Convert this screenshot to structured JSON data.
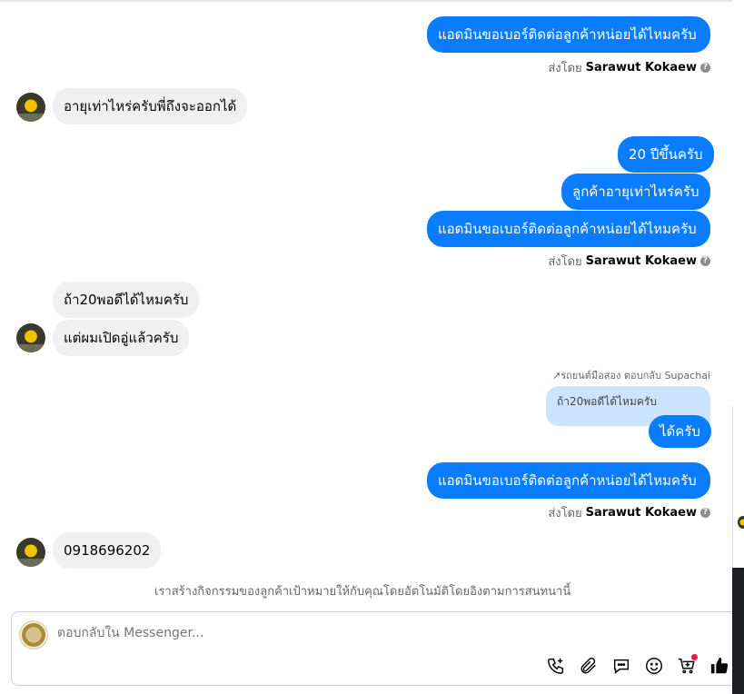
{
  "messages": [
    {
      "text": "แอดมินขอเบอร์ติดต่อลูกค้าหน่อยได้ไหมครับ"
    },
    {
      "sender_prefix": "ส่งโดย",
      "sender_name": "Sarawut Kokaew"
    },
    {
      "text": "อายุเท่าไหร่ครับพี่ถึงจะออกได้"
    },
    {
      "text": "20 ปีขึ้นครับ"
    },
    {
      "text": "ลูกค้าอายุเท่าไหร่ครับ"
    },
    {
      "text": "แอดมินขอเบอร์ติดต่อลูกค้าหน่อยได้ไหมครับ"
    },
    {
      "sender_prefix": "ส่งโดย",
      "sender_name": "Sarawut Kokaew"
    },
    {
      "text": "ถ้า20พอดีได้ไหมครับ"
    },
    {
      "text": "แต่ผมเปิดอู่แล้วครับ"
    },
    {
      "reply_note": "รถยนต์มือสอง ตอบกลับ Supachai",
      "quoted": "ถ้า20พอดีได้ไหมครับ"
    },
    {
      "text": "ได้ครับ"
    },
    {
      "text": "แอดมินขอเบอร์ติดต่อลูกค้าหน่อยได้ไหมครับ"
    },
    {
      "sender_prefix": "ส่งโดย",
      "sender_name": "Sarawut Kokaew"
    },
    {
      "text": "0918696202"
    }
  ],
  "system_note": "เราสร้างกิจกรรมของลูกค้าเป้าหมายให้กับคุณโดยอัตโนมัติโดยอิงตามการสนทนานี้",
  "composer": {
    "placeholder": "ตอบกลับใน Messenger..."
  },
  "tools": [
    "phone-plus-icon",
    "paperclip-icon",
    "chat-bubble-icon",
    "emoji-icon",
    "cart-plus-icon",
    "thumbs-up-icon"
  ],
  "colors": {
    "outgoing": "#0a7cff",
    "incoming": "#f0f0f0",
    "quoted": "#cce4ff",
    "notify_dot": "#e41e3f"
  }
}
